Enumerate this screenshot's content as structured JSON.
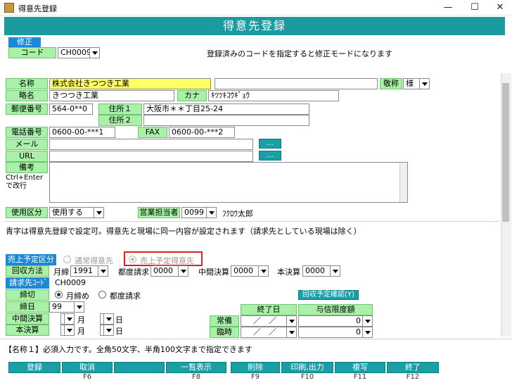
{
  "window": {
    "title": "得意先登録",
    "minimize": "—",
    "maximize": "☐",
    "close": "✕"
  },
  "header": {
    "title": "得意先登録"
  },
  "mode_badge": "修正",
  "code": {
    "label": "コード",
    "value": "CH0009",
    "note": "登録済みのコードを指定すると修正モードになります"
  },
  "name": {
    "label": "名称",
    "value": "株式会社きつつき工業",
    "value2": "",
    "honorific_label": "敬称",
    "honorific": "様"
  },
  "short": {
    "label": "略名",
    "value": "きつつき工業",
    "kana_label": "カナ",
    "kana": "ｷﾂﾂｷｺｳｷﾞｮｳ"
  },
  "postal": {
    "label": "郵便番号",
    "value": "564-0**0"
  },
  "addr1": {
    "label": "住所１",
    "value": "大阪市＊＊丁目25-24"
  },
  "addr2": {
    "label": "住所２",
    "value": ""
  },
  "phone": {
    "label": "電話番号",
    "value": "0600-00-***1",
    "fax_label": "FAX",
    "fax": "0600-00-***2"
  },
  "mail": {
    "label": "メール",
    "value": "",
    "btn": "..."
  },
  "url": {
    "label": "URL",
    "value": "",
    "btn": "..."
  },
  "memo": {
    "label": "備考",
    "hint": "Ctrl+Enterで改行",
    "value": ""
  },
  "usage": {
    "label": "使用区分",
    "value": "使用する",
    "staff_label": "営業担当者",
    "staff_code": "0099",
    "staff_name": "ﾌｸﾛｳ太郎"
  },
  "info_note": "青字は得意先登録で設定可。得意先と現場に同一内容が設定されます（請求先としている現場は除く）",
  "sales_type": {
    "label": "売上予定区分",
    "opt1": "通常得意先",
    "opt2": "売上予定得意先"
  },
  "collection": {
    "label": "回収方法",
    "month_label": "月締",
    "month_value": "1991",
    "each_label": "都度請求",
    "each_value": "0000",
    "mid_label": "中間決算",
    "mid_value": "0000",
    "final_label": "本決算",
    "final_value": "0000"
  },
  "bill_code": {
    "label": "請求先ｺｰﾄﾞ",
    "value": "CH0009"
  },
  "closing": {
    "label": "締切",
    "opt1": "月締め",
    "opt2": "都度請求"
  },
  "closing_day": {
    "label": "締日",
    "value": "99"
  },
  "collect_confirm_btn": "回収予定確認(Y)",
  "mid_close": {
    "label": "中間決算",
    "month": "月",
    "day": "日"
  },
  "final_close": {
    "label": "本決算",
    "month": "月",
    "day": "日"
  },
  "credit": {
    "end_date_header": "終了日",
    "limit_header": "与信限度額",
    "row1_label": "常備",
    "row1_date": "／　／",
    "row1_amount": "0",
    "row2_label": "臨時",
    "row2_date": "／　／",
    "row2_amount": "0"
  },
  "status_msg": "【名称１】必須入力です。全角50文字、半角100文字まで指定できます",
  "footer": [
    {
      "label": "登録",
      "key": ""
    },
    {
      "label": "取消",
      "key": "F6"
    },
    {
      "label": "",
      "key": ""
    },
    {
      "label": "一覧表示",
      "key": "F8"
    },
    {
      "label": "削除",
      "key": "F9"
    },
    {
      "label": "印刷,出力",
      "key": "F10"
    },
    {
      "label": "複写",
      "key": "F11"
    },
    {
      "label": "終了",
      "key": "F12"
    }
  ],
  "colors": {
    "header": "#1b9aa0",
    "label_bg": "#a9f0a9",
    "name_input": "#ffff66",
    "blue_label": "#1e88d8",
    "highlight_box": "#e02020"
  }
}
